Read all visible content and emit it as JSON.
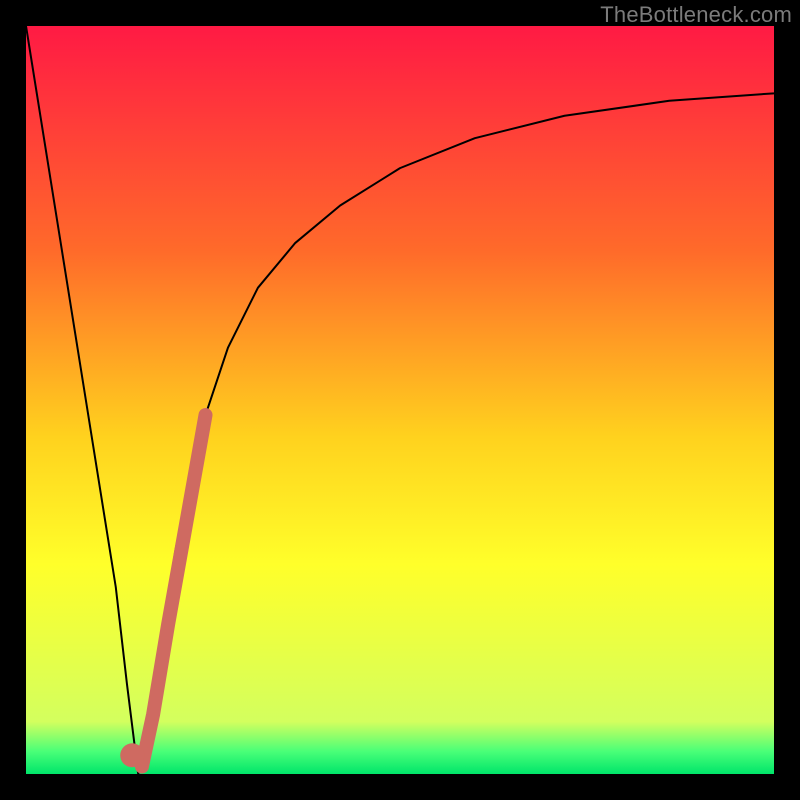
{
  "watermark": "TheBottleneck.com",
  "chart_data": {
    "type": "line",
    "title": "",
    "xlabel": "",
    "ylabel": "",
    "xlim": [
      0,
      100
    ],
    "ylim": [
      0,
      100
    ],
    "background_gradient": {
      "stops": [
        {
          "y": 0,
          "color": "#ff1a44"
        },
        {
          "y": 30,
          "color": "#ff6a2a"
        },
        {
          "y": 55,
          "color": "#ffd21e"
        },
        {
          "y": 72,
          "color": "#ffff2a"
        },
        {
          "y": 93,
          "color": "#d3ff5e"
        },
        {
          "y": 97,
          "color": "#49ff78"
        },
        {
          "y": 100,
          "color": "#00e56a"
        }
      ]
    },
    "series": [
      {
        "name": "bottleneck-curve",
        "color": "#000000",
        "stroke_width": 2,
        "x": [
          0,
          4,
          8,
          12,
          13.5,
          15,
          17,
          20,
          23,
          27,
          31,
          36,
          42,
          50,
          60,
          72,
          86,
          100
        ],
        "values": [
          0,
          25,
          50,
          75,
          88,
          100,
          88,
          70,
          55,
          43,
          35,
          29,
          24,
          19,
          15,
          12,
          10,
          9
        ]
      },
      {
        "name": "highlight-segment",
        "color": "#cf6a61",
        "stroke_width": 14,
        "linecap": "round",
        "x": [
          15.5,
          17.0,
          19.0,
          21.5,
          24.0
        ],
        "values": [
          99.0,
          92.0,
          80.0,
          66.0,
          52.0
        ]
      },
      {
        "name": "highlight-dot",
        "color": "#cf6a61",
        "type": "marker",
        "radius": 12,
        "x": [
          14.2
        ],
        "values": [
          97.5
        ]
      }
    ]
  }
}
